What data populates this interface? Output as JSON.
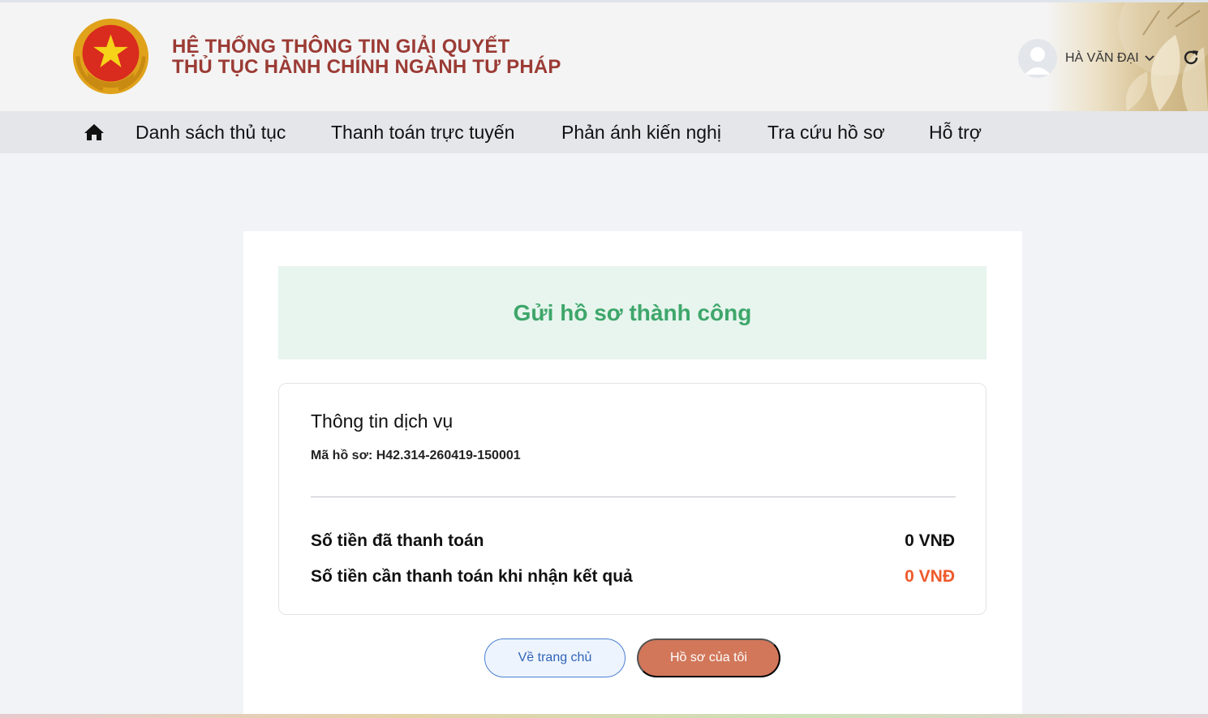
{
  "header": {
    "title_line1": "HỆ THỐNG THÔNG TIN GIẢI QUYẾT",
    "title_line2": "THỦ TỤC HÀNH CHÍNH NGÀNH TƯ PHÁP",
    "logo_icon": "national-emblem-icon",
    "user": {
      "name": "HÀ VĂN ĐẠI",
      "avatar_icon": "user-avatar-icon",
      "dropdown_icon": "chevron-down-icon"
    },
    "refresh_icon": "refresh-icon"
  },
  "nav": {
    "home_icon": "home-icon",
    "items": [
      {
        "label": "Danh sách thủ tục"
      },
      {
        "label": "Thanh toán trực tuyến"
      },
      {
        "label": "Phản ánh kiến nghị"
      },
      {
        "label": "Tra cứu hồ sơ"
      },
      {
        "label": "Hỗ trợ"
      }
    ]
  },
  "main": {
    "success_message": "Gửi hồ sơ thành công",
    "service_info": {
      "title": "Thông tin dịch vụ",
      "file_code": "Mã hồ sơ: H42.314-260419-150001",
      "paid_label": "Số tiền đã thanh toán",
      "paid_value": "0 VNĐ",
      "due_label": "Số tiền cần thanh toán khi nhận kết quả",
      "due_value": "0 VNĐ"
    },
    "buttons": {
      "home": "Về trang chủ",
      "my_files": "Hồ sơ của tôi"
    }
  },
  "colors": {
    "brand_title": "#9b3b35",
    "success_green": "#3ea66a",
    "success_bg": "#e7f5ee",
    "due_amount_red": "#ef5a2b",
    "primary_button": "#d2775a",
    "secondary_button_border": "#4a7fd1"
  }
}
